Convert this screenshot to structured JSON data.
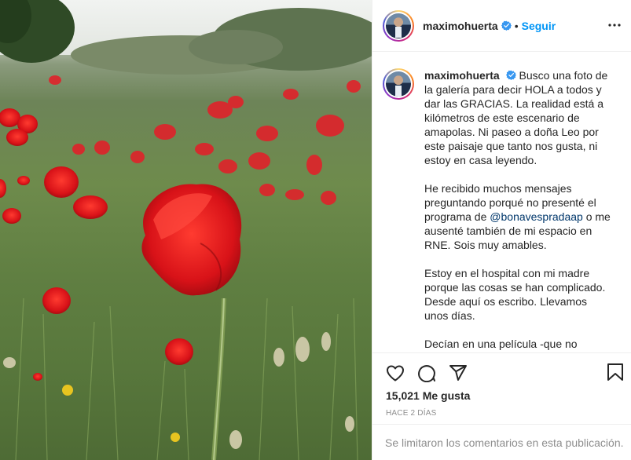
{
  "post": {
    "username": "maximohuerta",
    "follow_label": "Seguir",
    "separator": "•",
    "caption": {
      "username": "maximohuerta",
      "paragraphs": [
        "Busco una foto de la galería para decir HOLA a todos y dar las GRACIAS. La realidad está a kilómetros de este escenario de amapolas. Ni paseo a doña Leo por este paisaje que tanto nos gusta, ni estoy en casa leyendo.",
        "He recibido muchos mensajes preguntando porqué no presenté el programa de",
        "o me ausenté también de mi espacio en RNE. Sois muy amables.",
        "Estoy en el hospital con mi madre porque las cosas se han complicado. Desde aquí os escribo. Llevamos unos días.",
        "Decían en una película -que no"
      ],
      "mention": "@bonavespradaap"
    },
    "likes": "15,021 Me gusta",
    "time_ago": "HACE 2 DÍAS",
    "comments_disabled": "Se limitaron los comentarios en esta publicación."
  },
  "icons": {
    "verified": "verified-badge-icon",
    "more": "more-options-icon",
    "like": "heart-icon",
    "comment": "comment-icon",
    "share": "share-icon",
    "save": "bookmark-icon"
  },
  "colors": {
    "accent": "#0095f6",
    "verified": "#3897f0",
    "poppy": "#d8141a",
    "muted": "#8e8e8e"
  }
}
